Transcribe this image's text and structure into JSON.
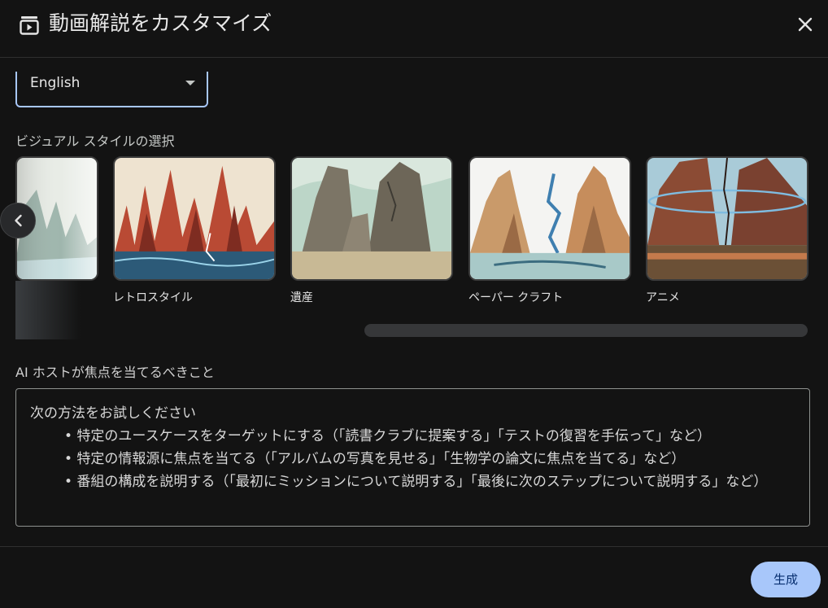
{
  "header": {
    "title": "動画解説をカスタマイズ",
    "icon": "video-overview-icon",
    "close_icon": "close-icon"
  },
  "language": {
    "selected": "English",
    "icon": "dropdown-arrow-icon"
  },
  "visual_style": {
    "label": "ビジュアル スタイルの選択",
    "prev_icon": "chevron-left-icon",
    "cards": [
      {
        "id": "partial",
        "label": ""
      },
      {
        "id": "retro",
        "label": "レトロスタイル"
      },
      {
        "id": "heritage",
        "label": "遺産"
      },
      {
        "id": "papercraft",
        "label": "ペーパー クラフト"
      },
      {
        "id": "anime",
        "label": "アニメ"
      }
    ]
  },
  "focus": {
    "label": "AI ホストが焦点を当てるべきこと",
    "placeholder_lines": [
      "次の方法をお試しください",
      "• 特定のユースケースをターゲットにする（「読書クラブに提案する」「テストの復習を手伝って」など）",
      "• 特定の情報源に焦点を当てる（「アルバムの写真を見せる」「生物学の論文に焦点を当てる」など）",
      "• 番組の構成を説明する（「最初にミッションについて説明する」「最後に次のステップについて説明する」など）"
    ]
  },
  "footer": {
    "generate_label": "生成"
  },
  "colors": {
    "background": "#131313",
    "accent": "#a8c7fa",
    "accent_text": "#062e6f"
  }
}
